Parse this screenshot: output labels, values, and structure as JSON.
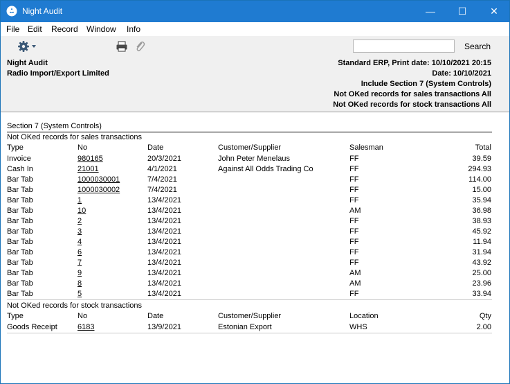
{
  "window": {
    "title": "Night Audit",
    "minimize": "—",
    "maximize": "☐",
    "close": "✕"
  },
  "menu": [
    "File",
    "Edit",
    "Record",
    "Window",
    "Info"
  ],
  "toolbar": {
    "search_value": "",
    "search_label": "Search"
  },
  "header": {
    "report_name": "Night Audit",
    "company": "Radio Import/Export Limited",
    "print_info": "Standard ERP, Print date: 10/10/2021 20:15",
    "date": "Date: 10/10/2021",
    "include": "Include Section 7 (System Controls)",
    "not_ok_sales": "Not OKed records for sales transactions All",
    "not_ok_stock": "Not OKed records for stock transactions All"
  },
  "report": {
    "section_title": "Section 7 (System Controls)",
    "sales": {
      "title": "Not OKed records for sales transactions",
      "columns": [
        "Type",
        "No",
        "Date",
        "Customer/Supplier",
        "Salesman",
        "Total"
      ],
      "rows": [
        [
          "Invoice",
          "980165",
          "20/3/2021",
          "John Peter Menelaus",
          "FF",
          "39.59"
        ],
        [
          "Cash In",
          "21001",
          "4/1/2021",
          "Against All Odds Trading Co",
          "FF",
          "294.93"
        ],
        [
          "Bar Tab",
          "1000030001",
          "7/4/2021",
          "",
          "FF",
          "114.00"
        ],
        [
          "Bar Tab",
          "1000030002",
          "7/4/2021",
          "",
          "FF",
          "15.00"
        ],
        [
          "Bar Tab",
          "1",
          "13/4/2021",
          "",
          "FF",
          "35.94"
        ],
        [
          "Bar Tab",
          "10",
          "13/4/2021",
          "",
          "AM",
          "36.98"
        ],
        [
          "Bar Tab",
          "2",
          "13/4/2021",
          "",
          "FF",
          "38.93"
        ],
        [
          "Bar Tab",
          "3",
          "13/4/2021",
          "",
          "FF",
          "45.92"
        ],
        [
          "Bar Tab",
          "4",
          "13/4/2021",
          "",
          "FF",
          "11.94"
        ],
        [
          "Bar Tab",
          "6",
          "13/4/2021",
          "",
          "FF",
          "31.94"
        ],
        [
          "Bar Tab",
          "7",
          "13/4/2021",
          "",
          "FF",
          "43.92"
        ],
        [
          "Bar Tab",
          "9",
          "13/4/2021",
          "",
          "AM",
          "25.00"
        ],
        [
          "Bar Tab",
          "8",
          "13/4/2021",
          "",
          "AM",
          "23.96"
        ],
        [
          "Bar Tab",
          "5",
          "13/4/2021",
          "",
          "FF",
          "33.94"
        ]
      ]
    },
    "stock": {
      "title": "Not OKed records for stock transactions",
      "columns": [
        "Type",
        "No",
        "Date",
        "Customer/Supplier",
        "Location",
        "Qty"
      ],
      "rows": [
        [
          "Goods Receipt",
          "6183",
          "13/9/2021",
          "Estonian Export",
          "WHS",
          "2.00"
        ]
      ]
    }
  }
}
